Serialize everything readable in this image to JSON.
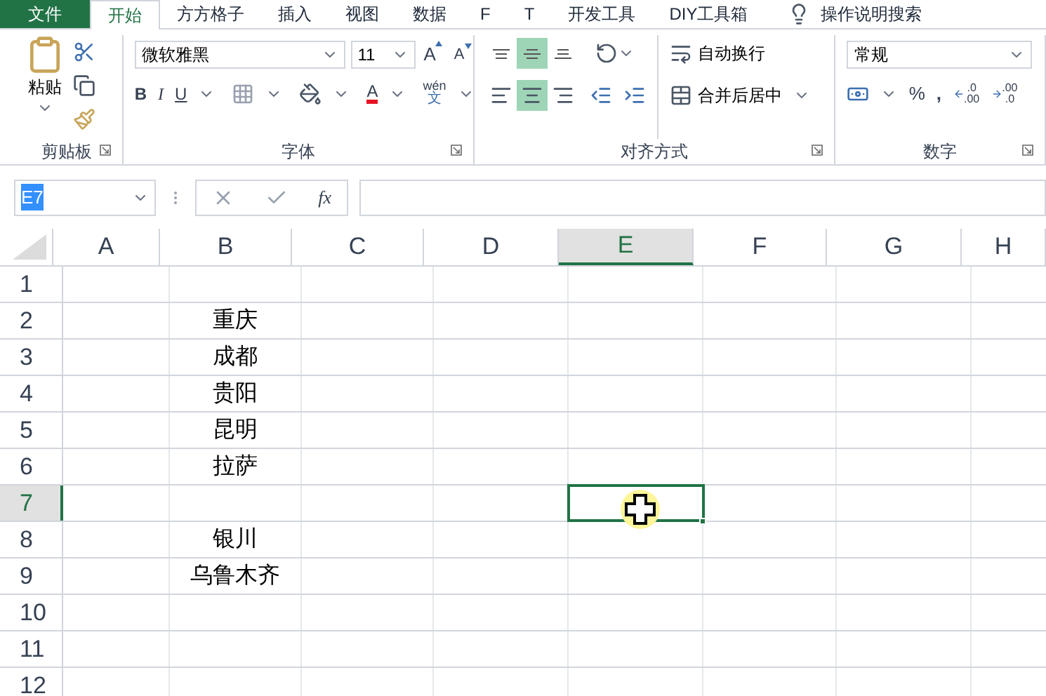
{
  "tabs": [
    {
      "label": "文件",
      "kind": "file",
      "selected": false
    },
    {
      "label": "开始",
      "kind": "tab",
      "selected": true
    },
    {
      "label": "方方格子",
      "kind": "tab",
      "selected": false
    },
    {
      "label": "插入",
      "kind": "tab",
      "selected": false
    },
    {
      "label": "视图",
      "kind": "tab",
      "selected": false
    },
    {
      "label": "数据",
      "kind": "tab",
      "selected": false
    },
    {
      "label": "F",
      "kind": "tab",
      "selected": false
    },
    {
      "label": "T",
      "kind": "tab",
      "selected": false
    },
    {
      "label": "开发工具",
      "kind": "tab",
      "selected": false
    },
    {
      "label": "DIY工具箱",
      "kind": "tab",
      "selected": false
    },
    {
      "label": "操作说明搜索",
      "kind": "search",
      "selected": false
    }
  ],
  "clipboard": {
    "paste": "粘贴",
    "label": "剪贴板"
  },
  "font": {
    "name": "微软雅黑",
    "size": "11",
    "grow": "A",
    "shrink": "A",
    "bold": "B",
    "italic": "I",
    "underline": "U",
    "font_color": "A",
    "phonetic_top": "wén",
    "phonetic_bottom": "文",
    "label": "字体"
  },
  "alignment": {
    "vertical": [
      {
        "kind": "top",
        "selected": false
      },
      {
        "kind": "middle",
        "selected": true
      },
      {
        "kind": "bottom",
        "selected": false
      }
    ],
    "horizontal": [
      {
        "kind": "left",
        "selected": false
      },
      {
        "kind": "center",
        "selected": true
      },
      {
        "kind": "right",
        "selected": false
      }
    ],
    "wrap": "自动换行",
    "merge": "合并后居中",
    "label": "对齐方式"
  },
  "number": {
    "format": "常规",
    "percent": "%",
    "comma": ",",
    "increase_decimal": [
      ".0",
      ".00"
    ],
    "decrease_decimal": [
      ".00",
      ".0"
    ],
    "label": "数字"
  },
  "formula_bar": {
    "name_box": "E7",
    "fx": "fx"
  },
  "columns": [
    {
      "label": "A",
      "selected": false
    },
    {
      "label": "B",
      "selected": false
    },
    {
      "label": "C",
      "selected": false
    },
    {
      "label": "D",
      "selected": false
    },
    {
      "label": "E",
      "selected": true
    },
    {
      "label": "F",
      "selected": false
    },
    {
      "label": "G",
      "selected": false
    },
    {
      "label": "H",
      "selected": false
    }
  ],
  "rows": [
    {
      "label": "1",
      "selected": false,
      "cells": {}
    },
    {
      "label": "2",
      "selected": false,
      "cells": {
        "B": "重庆"
      }
    },
    {
      "label": "3",
      "selected": false,
      "cells": {
        "B": "成都"
      }
    },
    {
      "label": "4",
      "selected": false,
      "cells": {
        "B": "贵阳"
      }
    },
    {
      "label": "5",
      "selected": false,
      "cells": {
        "B": "昆明"
      }
    },
    {
      "label": "6",
      "selected": false,
      "cells": {
        "B": "拉萨"
      }
    },
    {
      "label": "7",
      "selected": true,
      "cells": {}
    },
    {
      "label": "8",
      "selected": false,
      "cells": {
        "B": "银川"
      }
    },
    {
      "label": "9",
      "selected": false,
      "cells": {
        "B": "乌鲁木齐"
      }
    },
    {
      "label": "10",
      "selected": false,
      "cells": {}
    },
    {
      "label": "11",
      "selected": false,
      "cells": {}
    },
    {
      "label": "12",
      "selected": false,
      "cells": {}
    }
  ]
}
